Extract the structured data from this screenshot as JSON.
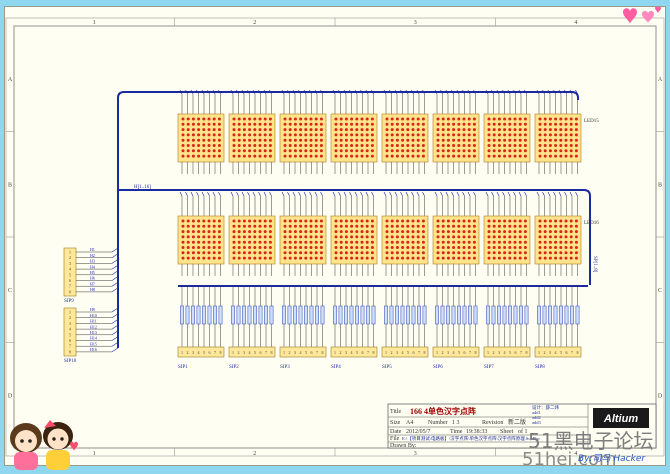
{
  "frame": {
    "cols": [
      "1",
      "2",
      "3",
      "4"
    ],
    "rows": [
      "A",
      "B",
      "C",
      "D"
    ]
  },
  "matrix_top_label": "LED15",
  "matrix_bottom_label": "LED16",
  "bus_label": "H[1..16]",
  "bus_label_right": "SP[1..8]",
  "sip_top_label": "SIP9",
  "sip_bottom_label": "SIP10",
  "sip_pins": [
    "1",
    "2",
    "3",
    "4",
    "5",
    "6",
    "7",
    "8"
  ],
  "net_top": [
    "H1",
    "H2",
    "H3",
    "H4",
    "H5",
    "H6",
    "H7",
    "H8"
  ],
  "net_bottom": [
    "H9",
    "H10",
    "H11",
    "H12",
    "H13",
    "H14",
    "H15",
    "H16"
  ],
  "connector_labels": [
    "SIP1",
    "SIP2",
    "SIP3",
    "SIP4",
    "SIP5",
    "SIP6",
    "SIP7",
    "SIP8"
  ],
  "title_block": {
    "title_label": "Title",
    "title_value": "166 4单色汉字点阵",
    "size_label": "Size",
    "size_value": "A4",
    "number_label": "Number",
    "number_value": "1 3",
    "revision_label": "Revision",
    "revision_value": "新二版",
    "date_label": "Date",
    "date_value": "2012/05/7",
    "time_label": "Time",
    "time_value": "19:38:33",
    "sheet_label": "Sheet",
    "sheet_value": "of 1",
    "file_label": "File",
    "file_value": "E:\\【项目测试\\电路板】\\汉字点阵\\单色汉字点阵\\汉字点阵原理.SchDoc",
    "drawn_label": "Drawn By:",
    "notes": [
      "设计：薛二炜",
      "add1",
      "add2",
      "add3"
    ],
    "logo": "Altium"
  },
  "watermark": {
    "forum": "51黑电子论坛",
    "site": "51hei.com",
    "author": "By:司马 Hacker"
  },
  "colors": {
    "background": "#8fd6ef",
    "sheet": "#fffef2",
    "wire": "#1c2aa0",
    "matrix_fill": "#ffe48c",
    "matrix_dot": "#d62718",
    "pin_lines": "#3a3a3a",
    "connector_fill": "#ffe89a"
  }
}
